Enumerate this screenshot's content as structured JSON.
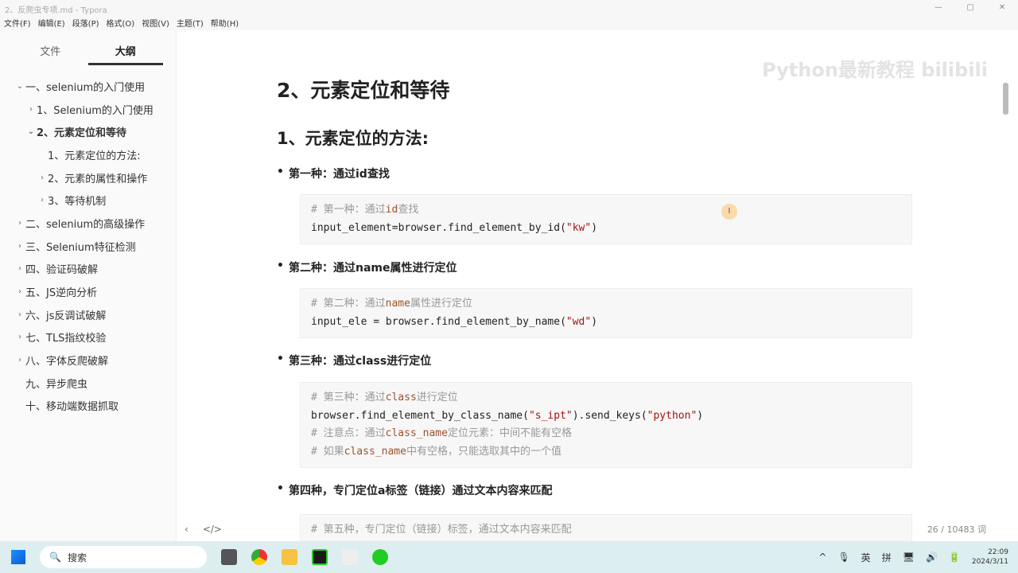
{
  "window": {
    "title": "2、反爬虫专项.md - Typora",
    "buttons": [
      "—",
      "▢",
      "✕"
    ]
  },
  "menu": [
    "文件(F)",
    "编辑(E)",
    "段落(P)",
    "格式(O)",
    "视图(V)",
    "主题(T)",
    "帮助(H)"
  ],
  "sidebar": {
    "tabs": [
      "文件",
      "大纲"
    ],
    "outline": [
      {
        "label": "一、selenium的入门使用",
        "chev": "⌄",
        "indent": 0
      },
      {
        "label": "1、Selenium的入门使用",
        "chev": "›",
        "indent": 1
      },
      {
        "label": "2、元素定位和等待",
        "chev": "⌄",
        "indent": 1,
        "bold": true
      },
      {
        "label": "1、元素定位的方法:",
        "chev": "",
        "indent": 2
      },
      {
        "label": "2、元素的属性和操作",
        "chev": "›",
        "indent": 2
      },
      {
        "label": "3、等待机制",
        "chev": "›",
        "indent": 2
      },
      {
        "label": "二、selenium的高级操作",
        "chev": "›",
        "indent": 0
      },
      {
        "label": "三、Selenium特征检测",
        "chev": "›",
        "indent": 0
      },
      {
        "label": "四、验证码破解",
        "chev": "›",
        "indent": 0
      },
      {
        "label": "五、JS逆向分析",
        "chev": "›",
        "indent": 0
      },
      {
        "label": "六、js反调试破解",
        "chev": "›",
        "indent": 0
      },
      {
        "label": "七、TLS指纹校验",
        "chev": "›",
        "indent": 0
      },
      {
        "label": "八、字体反爬破解",
        "chev": "›",
        "indent": 0
      },
      {
        "label": "九、异步爬虫",
        "chev": "",
        "indent": 0
      },
      {
        "label": "十、移动端数据抓取",
        "chev": "",
        "indent": 0
      }
    ],
    "footer": {
      "back": "‹",
      "source": "</>"
    }
  },
  "doc": {
    "h2": "2、元素定位和等待",
    "h3": "1、元素定位的方法:",
    "b1": "第一种：通过id查找",
    "c1": {
      "comment_a": "# 第一种：通过",
      "comment_k": "id",
      "comment_b": "查找",
      "code_a": "input_element=browser.find_element_by_id(",
      "str": "\"kw\"",
      "code_b": ")"
    },
    "b2": "第二种：通过name属性进行定位",
    "c2": {
      "comment_a": "# 第二种：通过",
      "comment_k": "name",
      "comment_b": "属性进行定位",
      "code_a": "input_ele = browser.find_element_by_name(",
      "str": "\"wd\"",
      "code_b": ")"
    },
    "b3": "第三种：通过class进行定位",
    "c3": {
      "comment_a": "# 第三种：通过",
      "comment_k": "class",
      "comment_b": "进行定位",
      "code_a": "browser.find_element_by_class_name(",
      "str": "\"s_ipt\"",
      "code_b": ").send_keys(",
      "str2": "\"python\"",
      "code_c": ")",
      "n1a": "# 注意点：通过",
      "n1k": "class_name",
      "n1b": "定位元素：中间不能有空格",
      "n2a": "# 如果",
      "n2k": "class_name",
      "n2b": "中有空格，只能选取其中的一个值"
    },
    "b4": "第四种，专门定位a标签（链接）通过文本内容来匹配",
    "c4": {
      "comment": "# 第五种，专门定位（链接）标签，通过文本内容来匹配"
    }
  },
  "status": {
    "words": "26 / 10483 词"
  },
  "watermark": "Python最新教程 bilibili",
  "taskbar": {
    "search": "搜索",
    "tray": [
      "^",
      "🎙",
      "英",
      "拼",
      "🖥",
      "🔊",
      "🔋"
    ],
    "time": "22:09",
    "date": "2024/3/11"
  }
}
